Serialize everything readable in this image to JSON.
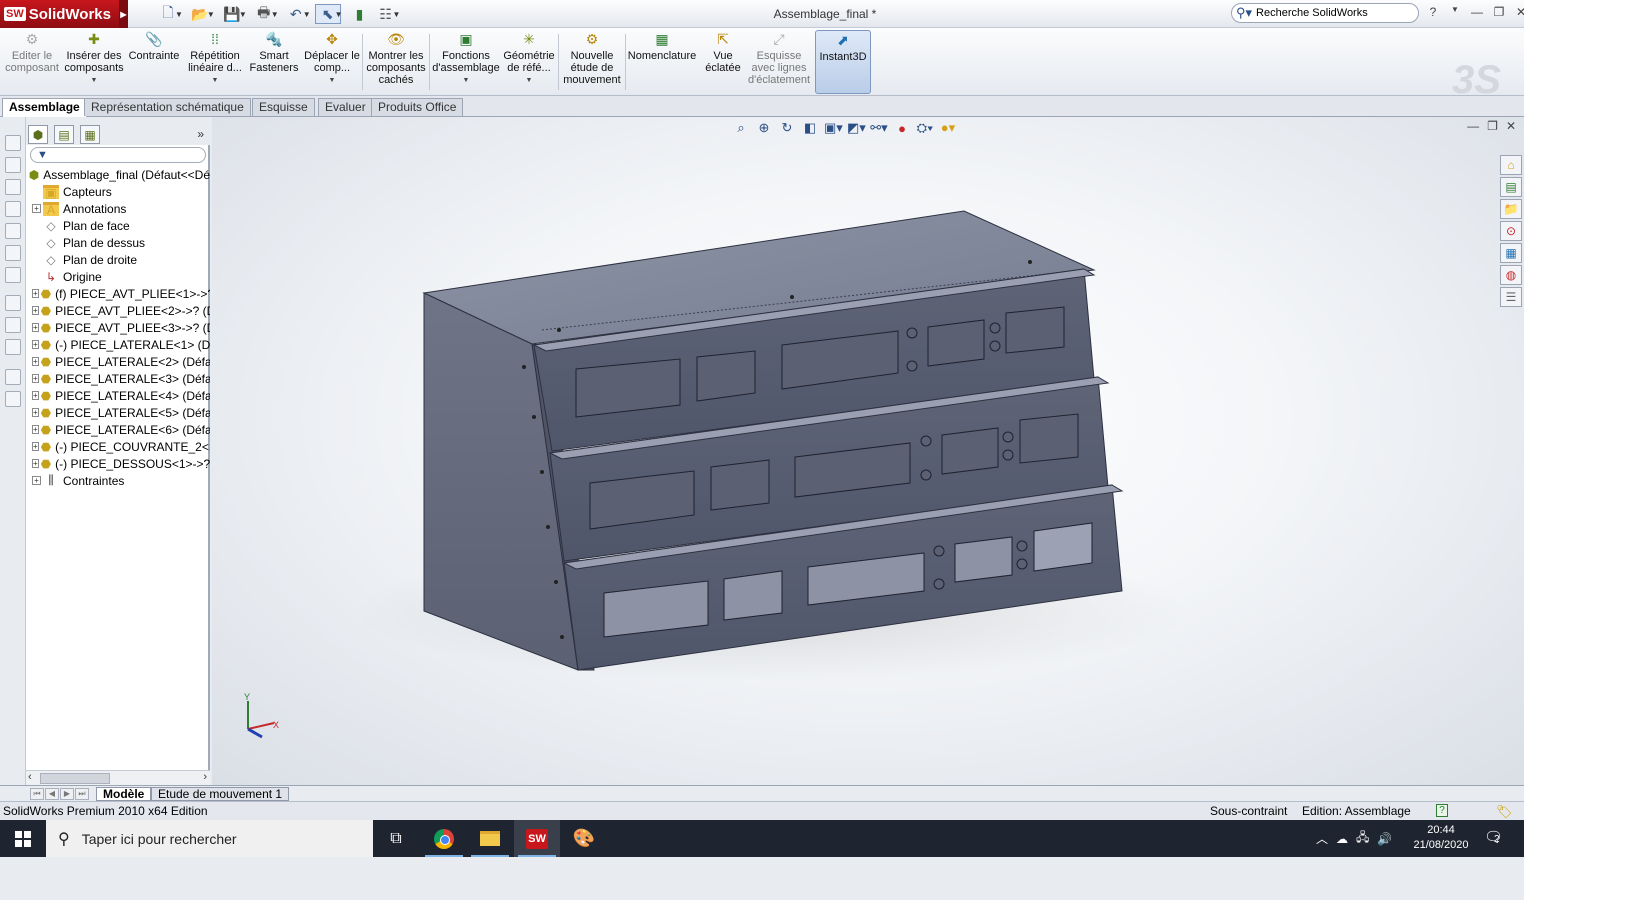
{
  "app": {
    "brand": "SolidWorks",
    "document_title": "Assemblage_final *",
    "search_placeholder": "Recherche SolidWorks",
    "help_icon": "?"
  },
  "ribbon": {
    "buttons": [
      {
        "label": "Editer le composant",
        "icon": "edit-component-icon",
        "disabled": true
      },
      {
        "label": "Insérer des composants",
        "icon": "insert-components-icon"
      },
      {
        "label": "Contrainte",
        "icon": "mate-icon"
      },
      {
        "label": "Répétition linéaire d...",
        "icon": "linear-pattern-icon"
      },
      {
        "label": "Smart Fasteners",
        "icon": "smart-fasteners-icon"
      },
      {
        "label": "Déplacer le comp...",
        "icon": "move-component-icon"
      },
      {
        "label": "Montrer les composants cachés",
        "icon": "show-hidden-icon"
      },
      {
        "label": "Fonctions d'assemblage",
        "icon": "assembly-features-icon"
      },
      {
        "label": "Géométrie de réfé...",
        "icon": "reference-geometry-icon"
      },
      {
        "label": "Nouvelle étude de mouvement",
        "icon": "motion-study-icon"
      },
      {
        "label": "Nomenclature",
        "icon": "bom-icon"
      },
      {
        "label": "Vue éclatée",
        "icon": "exploded-view-icon"
      },
      {
        "label": "Esquisse avec lignes d'éclatement",
        "icon": "explode-line-sketch-icon",
        "disabled": true
      },
      {
        "label": "Instant3D",
        "icon": "instant3d-icon",
        "active": true
      }
    ]
  },
  "tabs": [
    "Assemblage",
    "Représentation schématique",
    "Esquisse",
    "Evaluer",
    "Produits Office"
  ],
  "tree": {
    "root": "Assemblage_final  (Défaut<<Dé",
    "items": [
      {
        "label": "Capteurs",
        "icon": "sensor-folder-icon",
        "expandable": false
      },
      {
        "label": "Annotations",
        "icon": "annotations-icon",
        "expandable": true
      },
      {
        "label": "Plan de face",
        "icon": "plane-icon",
        "expandable": false
      },
      {
        "label": "Plan de dessus",
        "icon": "plane-icon",
        "expandable": false
      },
      {
        "label": "Plan de droite",
        "icon": "plane-icon",
        "expandable": false
      },
      {
        "label": "Origine",
        "icon": "origin-icon",
        "expandable": false
      },
      {
        "label": "(f) PIECE_AVT_PLIEE<1>->?",
        "icon": "part-icon",
        "expandable": true
      },
      {
        "label": "PIECE_AVT_PLIEE<2>->? (Dé",
        "icon": "part-icon",
        "expandable": true
      },
      {
        "label": "PIECE_AVT_PLIEE<3>->? (Dé",
        "icon": "part-icon",
        "expandable": true
      },
      {
        "label": "(-) PIECE_LATERALE<1> (Dé",
        "icon": "part-icon",
        "expandable": true
      },
      {
        "label": "PIECE_LATERALE<2> (Défau",
        "icon": "part-icon",
        "expandable": true
      },
      {
        "label": "PIECE_LATERALE<3> (Défau",
        "icon": "part-icon",
        "expandable": true
      },
      {
        "label": "PIECE_LATERALE<4> (Défau",
        "icon": "part-icon",
        "expandable": true
      },
      {
        "label": "PIECE_LATERALE<5> (Défau",
        "icon": "part-icon",
        "expandable": true
      },
      {
        "label": "PIECE_LATERALE<6> (Défau",
        "icon": "part-icon",
        "expandable": true
      },
      {
        "label": "(-) PIECE_COUVRANTE_2<1>",
        "icon": "part-icon",
        "expandable": true
      },
      {
        "label": "(-) PIECE_DESSOUS<1>->? (",
        "icon": "part-icon",
        "expandable": true
      },
      {
        "label": "Contraintes",
        "icon": "mates-folder-icon",
        "expandable": true
      }
    ]
  },
  "bottom_tabs": [
    "Modèle",
    "Etude de mouvement 1"
  ],
  "status": {
    "edition": "SolidWorks Premium 2010 x64 Edition",
    "constraint": "Sous-contraint",
    "mode": "Edition: Assemblage"
  },
  "taskbar": {
    "search_placeholder": "Taper ici pour rechercher",
    "time": "20:44",
    "date": "21/08/2020",
    "notifications": "2"
  },
  "triad": {
    "x": "X",
    "y": "Y"
  }
}
